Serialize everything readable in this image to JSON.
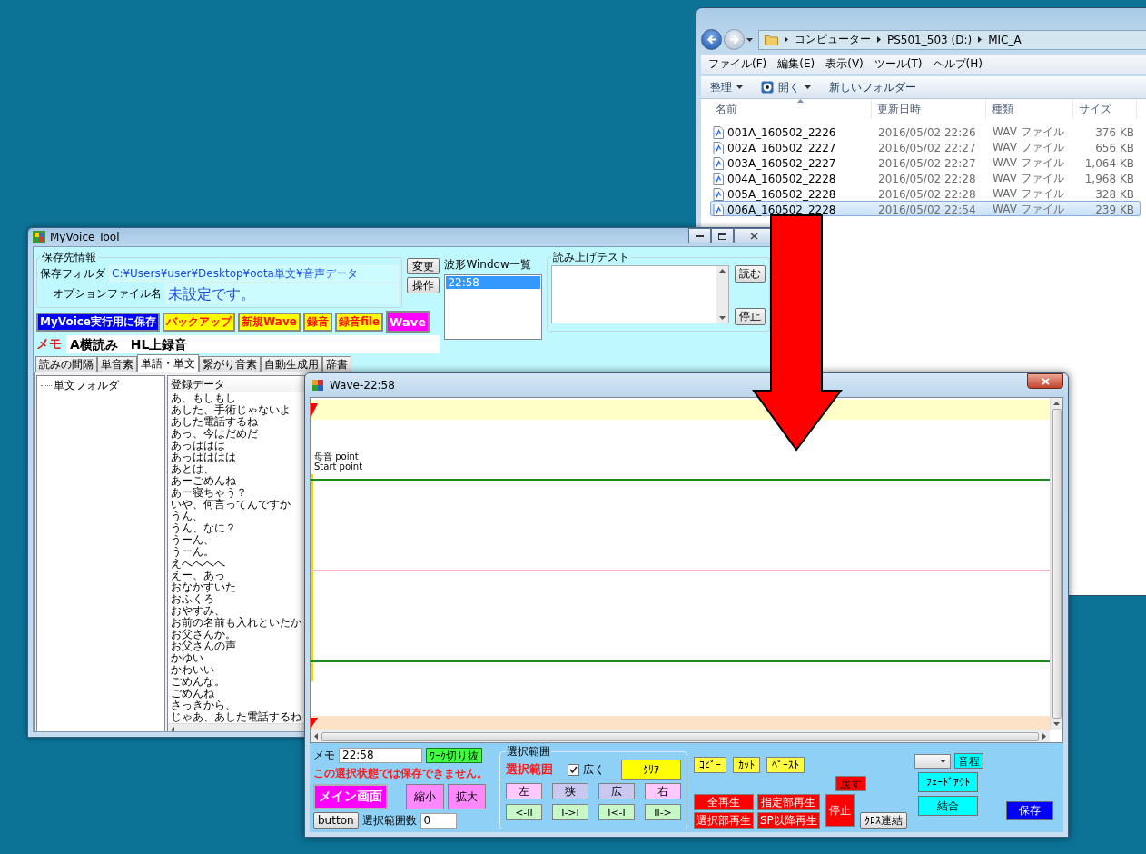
{
  "explorer": {
    "breadcrumb": [
      "コンピューター",
      "PS501_503 (D:)",
      "MIC_A"
    ],
    "menu": [
      "ファイル(F)",
      "編集(E)",
      "表示(V)",
      "ツール(T)",
      "ヘルプ(H)"
    ],
    "toolbar": [
      {
        "label": "整理",
        "kind": "dropdown"
      },
      {
        "label": "開く",
        "kind": "split"
      },
      {
        "label": "新しいフォルダー",
        "kind": "plain"
      }
    ],
    "columns": [
      "名前",
      "更新日時",
      "種類",
      "サイズ"
    ],
    "rows": [
      {
        "name": "001A_160502_2226",
        "modified": "2016/05/02 22:26",
        "type": "WAV ファイル",
        "size": "376 KB",
        "selected": false
      },
      {
        "name": "002A_160502_2227",
        "modified": "2016/05/02 22:27",
        "type": "WAV ファイル",
        "size": "656 KB",
        "selected": false
      },
      {
        "name": "003A_160502_2227",
        "modified": "2016/05/02 22:27",
        "type": "WAV ファイル",
        "size": "1,064 KB",
        "selected": false
      },
      {
        "name": "004A_160502_2228",
        "modified": "2016/05/02 22:28",
        "type": "WAV ファイル",
        "size": "1,968 KB",
        "selected": false
      },
      {
        "name": "005A_160502_2228",
        "modified": "2016/05/02 22:28",
        "type": "WAV ファイル",
        "size": "328 KB",
        "selected": false
      },
      {
        "name": "006A_160502_2228",
        "modified": "2016/05/02 22:54",
        "type": "WAV ファイル",
        "size": "239 KB",
        "selected": true
      }
    ]
  },
  "myvoice": {
    "title": "MyVoice Tool",
    "save_group": {
      "legend": "保存先情報",
      "folder_label": "保存フォルダ",
      "folder_value": "C:¥Users¥user¥Desktop¥oota単文¥音声データ",
      "option_label": "オプションファイル名",
      "option_value": "未設定です。",
      "buttons": [
        "変更",
        "操作"
      ]
    },
    "action_buttons": [
      {
        "label": "MyVoice実行用に保存",
        "color": "#0000ff"
      },
      {
        "label": "バックアップ",
        "color": "#ffff00"
      },
      {
        "label": "新規Wave",
        "color": "#ffff00"
      },
      {
        "label": "録音",
        "color": "#ffff00"
      },
      {
        "label": "録音file",
        "color": "#ffff00"
      },
      {
        "label": "Wave",
        "color": "#ff00ff"
      }
    ],
    "memo": {
      "label": "メモ",
      "value": "A横読み　HL上録音"
    },
    "wave_list": {
      "label": "波形Window一覧",
      "items": [
        {
          "label": "22:58",
          "selected": true
        }
      ]
    },
    "read_test": {
      "legend": "読み上げテスト",
      "buttons": [
        "読む",
        "停止"
      ]
    },
    "tabs": [
      {
        "label": "読みの間隔",
        "selected": false
      },
      {
        "label": "単音素",
        "selected": false
      },
      {
        "label": "単語・単文",
        "selected": true
      },
      {
        "label": "繋がり音素",
        "selected": false
      },
      {
        "label": "自動生成用",
        "selected": false
      },
      {
        "label": "辞書",
        "selected": false
      }
    ],
    "tree": [
      {
        "label": "単文フォルダ"
      }
    ],
    "list": {
      "header": "登録データ",
      "items": [
        "あ、もしもし",
        "あした、手術じゃないよ",
        "あした電話するね",
        "あっ、今はだめだ",
        "あっははは",
        "あっはははは",
        "あとは、",
        "あーごめんね",
        "あー寝ちゃう？",
        "いや、何言ってんですか",
        "うん、",
        "うん、なに？",
        "うーん、",
        "うーん。",
        "えへへへへ",
        "えー、あっ",
        "おなかすいた",
        "おふくろ",
        "おやすみ、",
        "お前の名前も入れといたか",
        "お父さんか。",
        "お父さんの声",
        "かゆい",
        "かわいい",
        "ごめんな。",
        "ごめんね",
        "さっきから、",
        "じゃあ、あした電話するね"
      ]
    }
  },
  "wave": {
    "title": "Wave-22:58",
    "markers": [
      "母音 point",
      "Start point"
    ],
    "memo": {
      "label": "メモ",
      "value": "22:58"
    },
    "cut_button": "ﾜｰｸ切り抜",
    "warning": "この選択状態では保存できません。",
    "main_button": "メイン画面",
    "zoom_buttons": [
      "縮小",
      "拡大"
    ],
    "count": {
      "label": "選択範囲数",
      "value": "0"
    },
    "small_button": "button",
    "range": {
      "legend": "選択範囲",
      "title": "選択範囲",
      "wide": {
        "label": "広く",
        "checked": true
      },
      "clear_button": "ｸﾘｱ",
      "move_buttons": [
        {
          "label": "左",
          "color": "#ffc8ff"
        },
        {
          "label": "狭",
          "color": "#c8c8f0"
        },
        {
          "label": "広",
          "color": "#c8c8f0"
        },
        {
          "label": "右",
          "color": "#ffc8ff"
        }
      ],
      "jump_buttons": [
        "<-II",
        "I->I",
        "I<-I",
        "II->"
      ]
    },
    "edit_buttons": [
      "ｺﾋﾟｰ",
      "ｶｯﾄ",
      "ﾍﾟｰｽﾄ"
    ],
    "undo_button": "戻す",
    "play_buttons": [
      "全再生",
      "指定部再生",
      "選択部再生",
      "SP以降再生"
    ],
    "stop_button": "停止",
    "cross_button": "ｸﾛｽ連結",
    "pitch_button": "音程",
    "fade_button": "ﾌｪｰﾄﾞｱｳﾄ",
    "join_button": "結合",
    "save_button": "保存"
  }
}
